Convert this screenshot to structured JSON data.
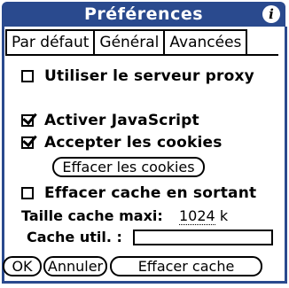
{
  "colors": {
    "title_bar": "#2a4a8e",
    "frame": "#2a4a8e"
  },
  "title": "Préférences",
  "info_icon": "i",
  "tabs": [
    {
      "label": "Par défaut",
      "active": false
    },
    {
      "label": "Général",
      "active": false
    },
    {
      "label": "Avancées",
      "active": true
    }
  ],
  "options": {
    "proxy": {
      "label": "Utiliser le serveur proxy",
      "checked": false
    },
    "javascript": {
      "label": "Activer JavaScript",
      "checked": true
    },
    "cookies": {
      "label": "Accepter les cookies",
      "checked": true
    },
    "clear_cookies_button": "Effacer les cookies",
    "clear_cache_on_exit": {
      "label": "Effacer cache en sortant",
      "checked": false
    }
  },
  "cache": {
    "max_label": "Taille cache maxi:",
    "max_value": "1024",
    "max_unit": "k",
    "used_label": "Cache util. :",
    "used_value": ""
  },
  "buttons": {
    "ok": "OK",
    "cancel": "Annuler",
    "clear_cache": "Effacer cache"
  }
}
